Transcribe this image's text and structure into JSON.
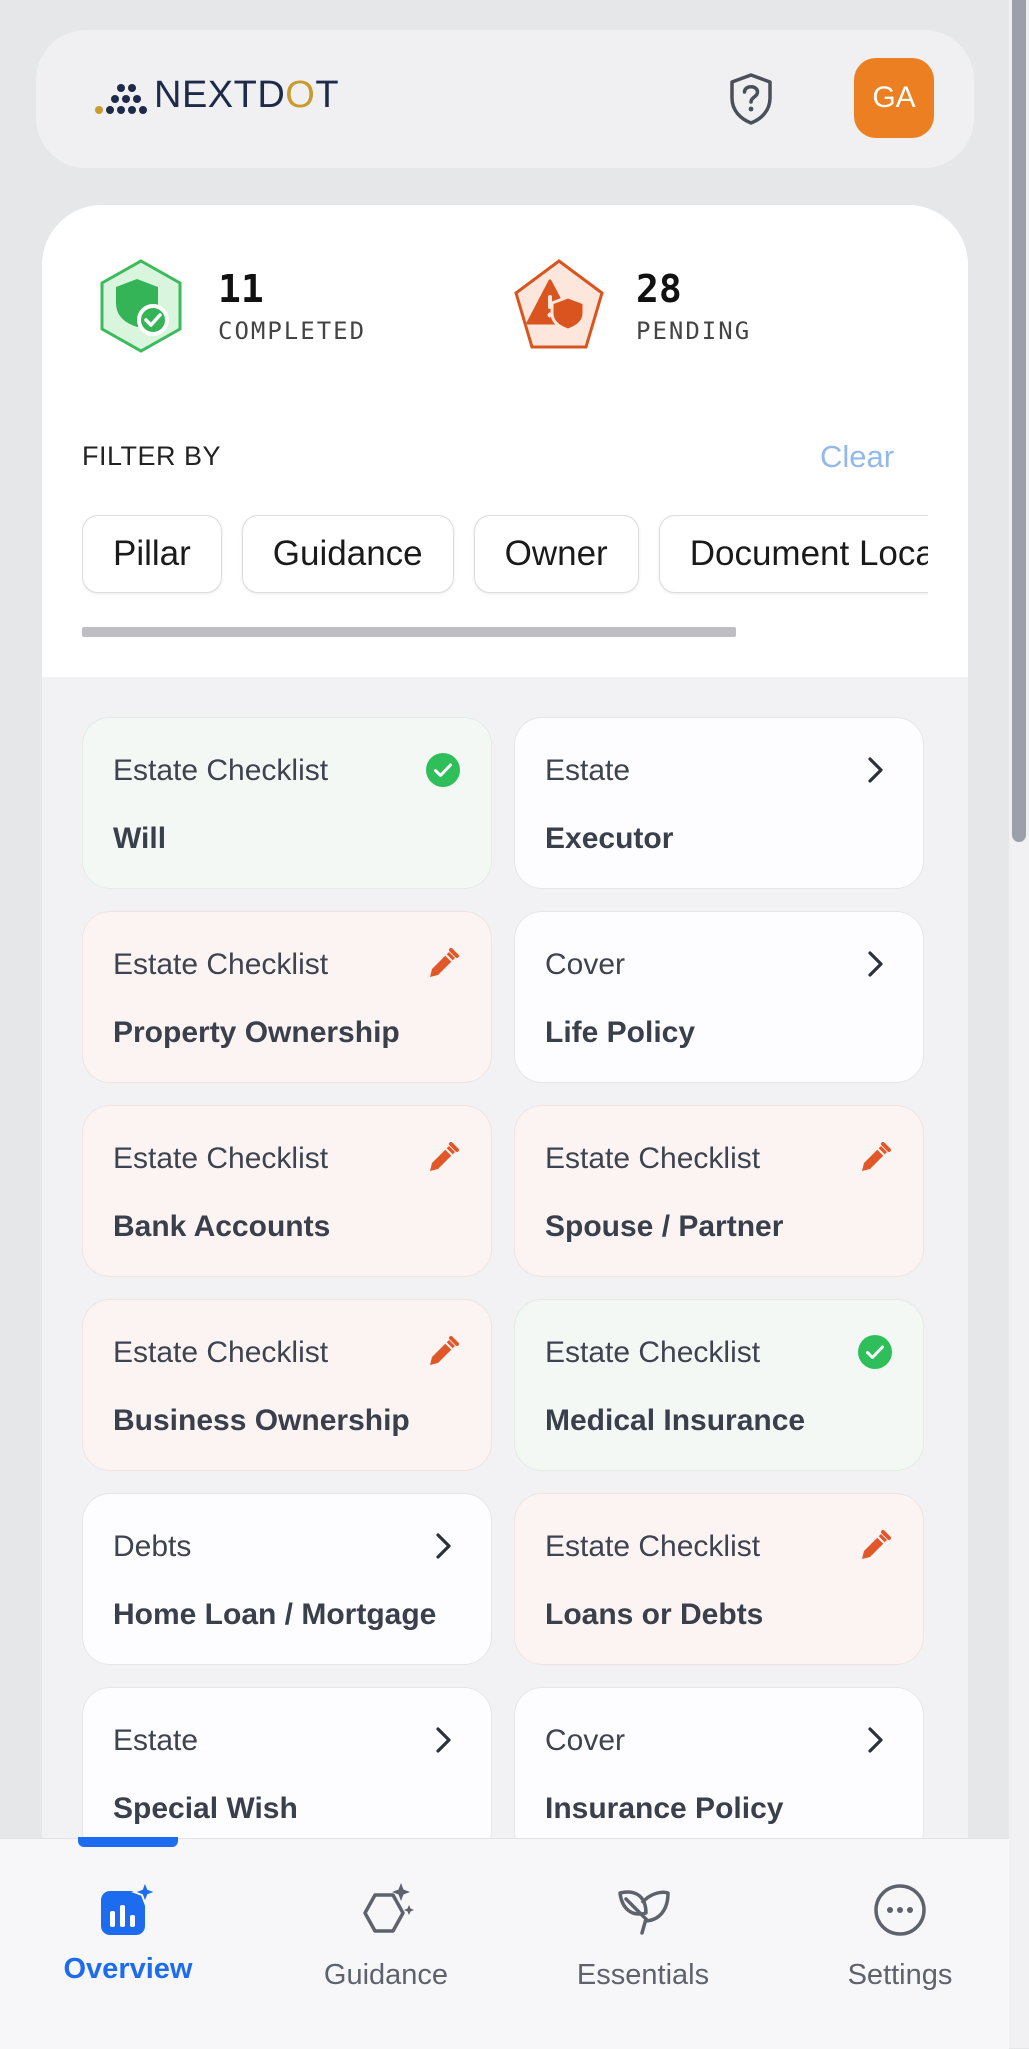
{
  "header": {
    "brand_prefix": "NEXTD",
    "brand_o": "O",
    "brand_suffix": "T",
    "help_icon": "shield-question-icon",
    "avatar_initials": "GA",
    "avatar_color": "#ec7f22"
  },
  "stats": {
    "completed": {
      "count": "11",
      "label": "COMPLETED",
      "icon": "shield-check-icon",
      "color": "#3dbb5c"
    },
    "pending": {
      "count": "28",
      "label": "PENDING",
      "icon": "warning-shield-icon",
      "color": "#d9541e"
    }
  },
  "filter": {
    "label": "FILTER BY",
    "clear": "Clear",
    "chips": [
      "Pillar",
      "Guidance",
      "Owner",
      "Document Location"
    ]
  },
  "cards": [
    {
      "category": "Estate Checklist",
      "title": "Will",
      "status": "completed",
      "icon": "check-circle-icon"
    },
    {
      "category": "Estate",
      "title": "Executor",
      "status": "nav",
      "icon": "chevron-right-icon"
    },
    {
      "category": "Estate Checklist",
      "title": "Property Ownership",
      "status": "edit",
      "icon": "pencil-icon"
    },
    {
      "category": "Cover",
      "title": "Life Policy",
      "status": "nav",
      "icon": "chevron-right-icon"
    },
    {
      "category": "Estate Checklist",
      "title": "Bank Accounts",
      "status": "edit",
      "icon": "pencil-icon"
    },
    {
      "category": "Estate Checklist",
      "title": "Spouse / Partner",
      "status": "edit",
      "icon": "pencil-icon"
    },
    {
      "category": "Estate Checklist",
      "title": "Business Ownership",
      "status": "edit",
      "icon": "pencil-icon"
    },
    {
      "category": "Estate Checklist",
      "title": "Medical Insurance",
      "status": "completed",
      "icon": "check-circle-icon"
    },
    {
      "category": "Debts",
      "title": "Home Loan / Mortgage",
      "status": "nav",
      "icon": "chevron-right-icon"
    },
    {
      "category": "Estate Checklist",
      "title": "Loans or Debts",
      "status": "edit",
      "icon": "pencil-icon"
    },
    {
      "category": "Estate",
      "title": "Special Wish",
      "status": "nav",
      "icon": "chevron-right-icon"
    },
    {
      "category": "Cover",
      "title": "Insurance Policy",
      "status": "nav",
      "icon": "chevron-right-icon"
    }
  ],
  "nav": {
    "items": [
      {
        "label": "Overview",
        "icon": "chart-sparkle-icon",
        "active": true
      },
      {
        "label": "Guidance",
        "icon": "hexagon-sparkle-icon",
        "active": false
      },
      {
        "label": "Essentials",
        "icon": "leaf-icon",
        "active": false
      },
      {
        "label": "Settings",
        "icon": "dots-circle-icon",
        "active": false
      }
    ],
    "accent": "#1d6cf0"
  }
}
